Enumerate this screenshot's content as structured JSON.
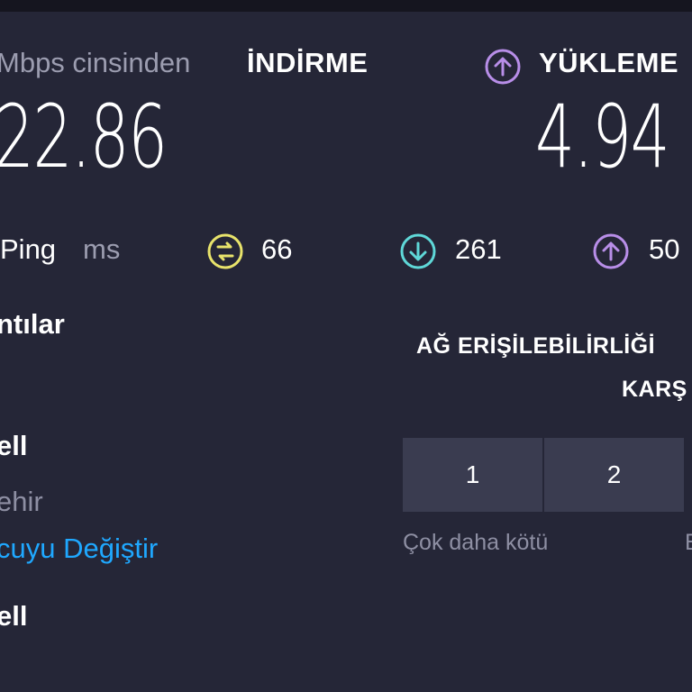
{
  "header": {
    "unit_text": "Mbps cinsinden",
    "download_label": "İNDİRME",
    "upload_label": "YÜKLEME",
    "upload_icon": "arrow-up-circle-icon"
  },
  "results": {
    "download": "22.86",
    "upload": "4.94"
  },
  "ping": {
    "label": "Ping",
    "unit": "ms",
    "idle": {
      "value": "66",
      "icon": "ping-jitter-icon",
      "color": "#e8e36b"
    },
    "download": {
      "value": "261",
      "icon": "arrow-down-circle-icon",
      "color": "#5fd8d8"
    },
    "upload": {
      "value": "50",
      "icon": "arrow-up-circle-icon",
      "color": "#b88ee8"
    }
  },
  "connections": {
    "heading": "ntılar",
    "provider": "ell",
    "location": "ehir",
    "change_server": "cuyu Değiştir",
    "server": "ell"
  },
  "survey": {
    "title": "AĞ ERİŞİLEBİLİRLİĞİ",
    "subtitle": "KARŞ",
    "options": [
      "1",
      "2"
    ],
    "low_label": "Çok daha kötü",
    "high_label": "B"
  },
  "colors": {
    "background": "#252637",
    "accent_link": "#1fa8ff",
    "upload_accent": "#b88ee8"
  }
}
